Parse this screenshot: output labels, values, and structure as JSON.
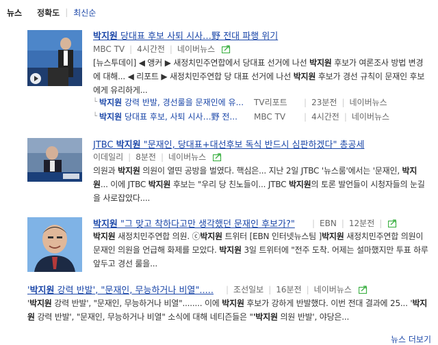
{
  "tabs": {
    "news": "뉴스",
    "accuracy": "정확도",
    "latest": "최신순"
  },
  "colors": {
    "link": "#1a46a8",
    "share_green": "#3cb043"
  },
  "articles": [
    {
      "title_name": "박지원",
      "title_rest": " 당대표 후보 사퇴 시사…野 전대 파행 위기",
      "source": "MBC TV",
      "time": "4시간전",
      "naver": "네이버뉴스",
      "desc": [
        {
          "t": "[뉴스투데이] ◀ 앵커 ▶ 새정치민주연합에서 당대표 선거에 나선 "
        },
        {
          "b": "박지원"
        },
        {
          "t": " 후보가 여론조사 방법 변경에 대해... ◀ 리포트 ▶ 새정치민주연합 당 대표 선거에 나선 "
        },
        {
          "b": "박지원"
        },
        {
          "t": " 후보가 경선 규칙이 문재인 후보에게 유리하게..."
        }
      ],
      "related": [
        {
          "name": "박지원",
          "rest": " 강력 반발, 경선룰을 문재인에 유...",
          "source": "TV리포트",
          "time": "23분전",
          "naver": "네이버뉴스"
        },
        {
          "name": "박지원",
          "rest": " 당대표 후보, 사퇴 시사…野 전...",
          "source": "MBC TV",
          "time": "4시간전",
          "naver": "네이버뉴스"
        }
      ]
    },
    {
      "title_pre": "JTBC ",
      "title_name": "박지원",
      "title_rest": " \"문재인, 당대표+대선후보 독식 반드시 심판하겠다\" 총공세",
      "source": "이데일리",
      "time": "8분전",
      "naver": "네이버뉴스",
      "desc": [
        {
          "t": "의원과 "
        },
        {
          "b": "박지원"
        },
        {
          "t": " 의원이 열띤 공방을 벌였다. 핵심은... 지난 2일 JTBC '뉴스룸'에서는 '문재인, "
        },
        {
          "b": "박지원"
        },
        {
          "t": "... 이에 JTBC "
        },
        {
          "b": "박지원"
        },
        {
          "t": " 후보는 \"우리 당 친노들이... JTBC "
        },
        {
          "b": "박지원"
        },
        {
          "t": "의 토론 발언들이 시청자들의 눈길을 사로잡았다...."
        }
      ]
    },
    {
      "title_name": "박지원",
      "title_rest": " \"그 맞고 착하다고만 생각했던 문재인 후보가?\"",
      "source": "EBN",
      "time": "12분전",
      "desc": [
        {
          "b": "박지원"
        },
        {
          "t": " 새정치민주연합 의원. ⓒ"
        },
        {
          "b": "박지원"
        },
        {
          "t": " 트위터 [EBN 인터넷뉴스팀 ]"
        },
        {
          "b": "박지원"
        },
        {
          "t": " 새정치민주연합 의원이 문재인 의원을 언급해 화제를 모았다. "
        },
        {
          "b": "박지원"
        },
        {
          "t": " 3일 트위터에 \"전주 도착. 어제는 설마했지만 투표 하루 앞두고 경선 룰을..."
        }
      ]
    },
    {
      "title_q1": "'",
      "title_name": "박지원",
      "title_rest": " 강력 반발', \"문재인, 무능하거나 비열\".....",
      "source": "조선일보",
      "time": "16분전",
      "naver": "네이버뉴스",
      "desc": [
        {
          "t": "'"
        },
        {
          "b": "박지원"
        },
        {
          "t": " 강력 반발', \"문재인, 무능하거나 비열\"........ 이에 "
        },
        {
          "b": "박지원"
        },
        {
          "t": " 후보가 강하게 반발했다. 이번 전대 결과에 25... '"
        },
        {
          "b": "박지원"
        },
        {
          "t": " 강력 반발', \"문재인, 무능하거나 비열\" 소식에 대해 네티즌들은 \""
        },
        {
          "b": "'박지원"
        },
        {
          "t": " 의원 반발', 야당은..."
        }
      ]
    }
  ],
  "bottom_more": "뉴스 더보기"
}
